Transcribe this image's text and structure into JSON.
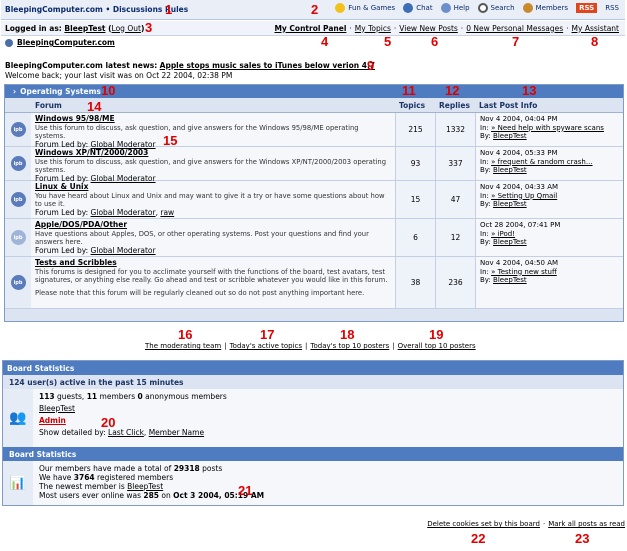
{
  "header": {
    "brand": "BleepingComputer.com • Discussions Rules",
    "links": [
      {
        "label": "Fun & Games",
        "icon": "smiley-icon"
      },
      {
        "label": "Chat",
        "icon": "chat-icon"
      },
      {
        "label": "Help",
        "icon": "help-icon"
      },
      {
        "label": "Search",
        "icon": "search-icon"
      },
      {
        "label": "Members",
        "icon": "members-icon"
      }
    ],
    "rss_badge": "RSS",
    "rss_label": "RSS"
  },
  "userbar": {
    "logged_in_prefix": "Logged in as:",
    "username": "BleepTest",
    "logout_label": "Log Out",
    "links": [
      "My Control Panel",
      "My Topics",
      "View New Posts",
      "0 New Personal Messages",
      "My Assistant"
    ]
  },
  "breadcrumb": "BleepingComputer.com",
  "news": {
    "prefix": "BleepingComputer.com latest news:",
    "headline": "Apple stops music sales to iTunes below verion 4.7",
    "welcome": "Welcome back; your last visit was on Oct 22 2004, 02:38 PM"
  },
  "category": {
    "title": "Operating Systems",
    "col_forum": "Forum",
    "col_topics": "Topics",
    "col_replies": "Replies",
    "col_last": "Last Post Info",
    "forums": [
      {
        "name": "Windows 95/98/ME",
        "desc": "Use this forum to discuss, ask question, and give answers for the Windows 95/98/ME operating systems.",
        "led_prefix": "Forum Led by:",
        "led": "Global Moderator",
        "led2": "",
        "topics": "215",
        "replies": "1332",
        "date": "Nov 4 2004, 04:04 PM",
        "in_prefix": "In:",
        "in": "» Need help with spyware scans",
        "by_prefix": "By:",
        "by": "BleepTest"
      },
      {
        "name": "Windows XP/NT/2000/2003",
        "desc": "Use this forum to discuss, ask question, and give answers for the Windows XP/NT/2000/2003 operating systems.",
        "led_prefix": "Forum Led by:",
        "led": "Global Moderator",
        "led2": "",
        "topics": "93",
        "replies": "337",
        "date": "Nov 4 2004, 05:33 PM",
        "in_prefix": "In:",
        "in": "» frequent & random crash...",
        "by_prefix": "By:",
        "by": "BleepTest"
      },
      {
        "name": "Linux & Unix",
        "desc": "You have heard about Linux and Unix and may want to give it a try or have some questions about how to use it.",
        "led_prefix": "Forum Led by:",
        "led": "Global Moderator",
        "led2": "raw",
        "topics": "15",
        "replies": "47",
        "date": "Nov 4 2004, 04:33 AM",
        "in_prefix": "In:",
        "in": "» Setting Up Qmail",
        "by_prefix": "By:",
        "by": "BleepTest"
      },
      {
        "name": "Apple/DOS/PDA/Other",
        "desc": "Have questions about Apples, DOS, or other operating systems. Post your questions and find your answers here.",
        "led_prefix": "Forum Led by:",
        "led": "Global Moderator",
        "led2": "",
        "topics": "6",
        "replies": "12",
        "date": "Oct 28 2004, 07:41 PM",
        "in_prefix": "In:",
        "in": "» iPod!",
        "by_prefix": "By:",
        "by": "BleepTest"
      },
      {
        "name": "Tests and Scribbles",
        "desc": "This forums is designed for you to acclimate yourself with the functions of the board, test avatars, test signatures, or anything else really. Go ahead and test or scribble whatever you would like in this forum.",
        "note": "Please note that this forum will be regularly cleaned out so do not post anything important here.",
        "led_prefix": "",
        "led": "",
        "led2": "",
        "topics": "38",
        "replies": "236",
        "date": "Nov 4 2004, 04:50 AM",
        "in_prefix": "In:",
        "in": "» Testing new stuff",
        "by_prefix": "By:",
        "by": "BleepTest"
      }
    ]
  },
  "mod_links": [
    "The moderating team",
    "Today's active topics",
    "Today's top 10 posters",
    "Overall top 10 posters"
  ],
  "stats": {
    "title": "Board Statistics",
    "active_line": "124 user(s) active in the past 15 minutes",
    "guests_line_a": "113",
    "guests_line_b": "guests,",
    "guests_line_c": "11",
    "guests_line_d": "members",
    "guests_line_e": "0",
    "guests_line_f": "anonymous members",
    "user1": "BleepTest",
    "user2": "Admin",
    "detail_prefix": "Show detailed by:",
    "detail_a": "Last Click",
    "detail_b": "Member Name",
    "sub_title": "Board Statistics",
    "posts_line_prefix": "Our members have made a total of",
    "posts_count": "29318",
    "posts_suffix": "posts",
    "reg_prefix": "We have",
    "reg_count": "3764",
    "reg_suffix": "registered members",
    "newest_prefix": "The newest member is",
    "newest": "BleepTest",
    "most_prefix": "Most users ever online was",
    "most_count": "285",
    "most_on": "on",
    "most_date": "Oct 3 2004, 05:19 AM"
  },
  "bottom_links": [
    "Delete cookies set by this board",
    "Mark all posts as read"
  ],
  "annotations": [
    "1",
    "2",
    "3",
    "4",
    "5",
    "6",
    "7",
    "8",
    "9",
    "10",
    "11",
    "12",
    "13",
    "14",
    "15",
    "16",
    "17",
    "18",
    "19",
    "20",
    "21",
    "22",
    "23"
  ]
}
